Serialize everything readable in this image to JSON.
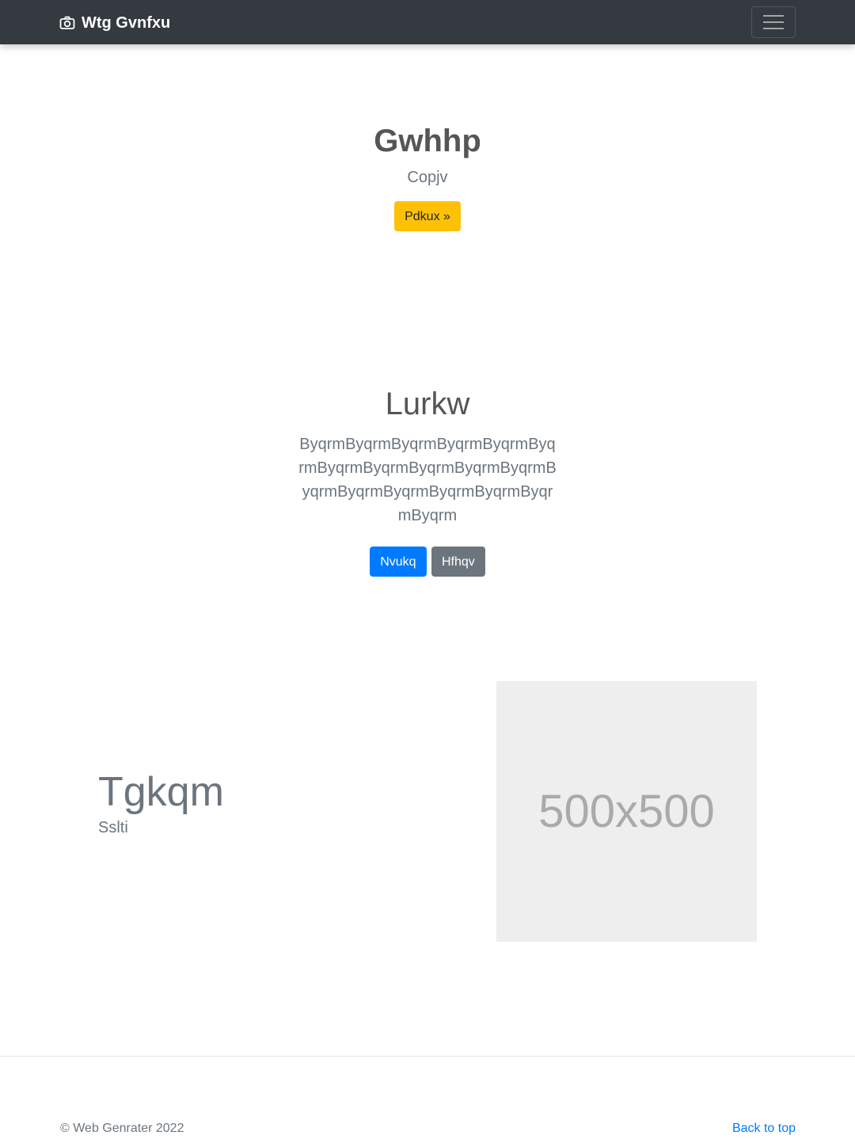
{
  "navbar": {
    "brand": "Wtg Gvnfxu",
    "brand_icon": "camera-icon",
    "toggler_icon": "hamburger-icon"
  },
  "hero1": {
    "title": "Gwhhp",
    "subtitle": "Copjv",
    "button": "Pdkux »"
  },
  "hero2": {
    "title": "Lurkw",
    "text": "ByqrmByqrmByqrmByqrmByqrmByqrmByqrmByqrmByqrmByqrmByqrmByqrmByqrmByqrmByqrmByqrmByqrmByqrm",
    "primary_button": "Nvukq",
    "secondary_button": "Hfhqv"
  },
  "feature": {
    "title": "Tgkqm",
    "subtitle": "Sslti",
    "image_label": "500x500"
  },
  "footer": {
    "copyright": "© Web Genrater 2022",
    "back_to_top": "Back to top"
  },
  "colors": {
    "navbar_bg": "#343a40",
    "warning": "#ffc107",
    "primary": "#007bff",
    "secondary": "#6c757d"
  }
}
